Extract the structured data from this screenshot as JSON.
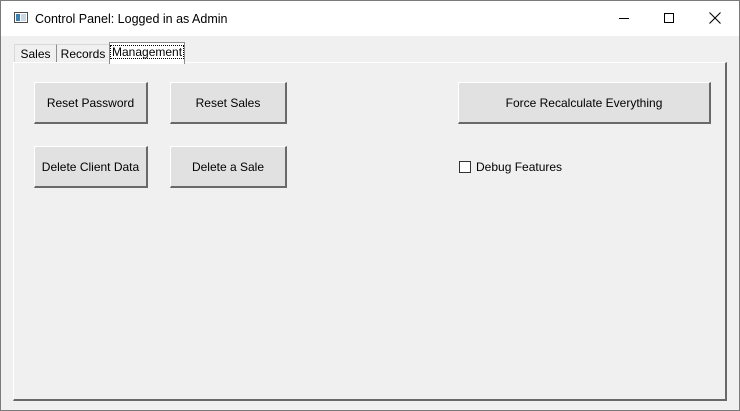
{
  "window": {
    "title": "Control Panel: Logged in as Admin",
    "icon": "app-window-icon"
  },
  "caption_buttons": {
    "minimize_icon": "minimize-icon",
    "maximize_icon": "maximize-icon",
    "close_icon": "close-icon"
  },
  "tabs": [
    {
      "label": "Sales",
      "selected": false
    },
    {
      "label": "Records",
      "selected": false
    },
    {
      "label": "Management",
      "selected": true
    }
  ],
  "management": {
    "buttons": {
      "reset_password": "Reset Password",
      "reset_sales": "Reset Sales",
      "force_recalculate": "Force Recalculate Everything",
      "delete_client_data": "Delete Client Data",
      "delete_sale": "Delete a Sale"
    },
    "debug_checkbox": {
      "label": "Debug Features",
      "checked": false
    }
  },
  "colors": {
    "window_background": "#f0f0f0",
    "titlebar_background": "#ffffff",
    "button_face": "#e1e1e1",
    "button_shadow": "#696969"
  }
}
